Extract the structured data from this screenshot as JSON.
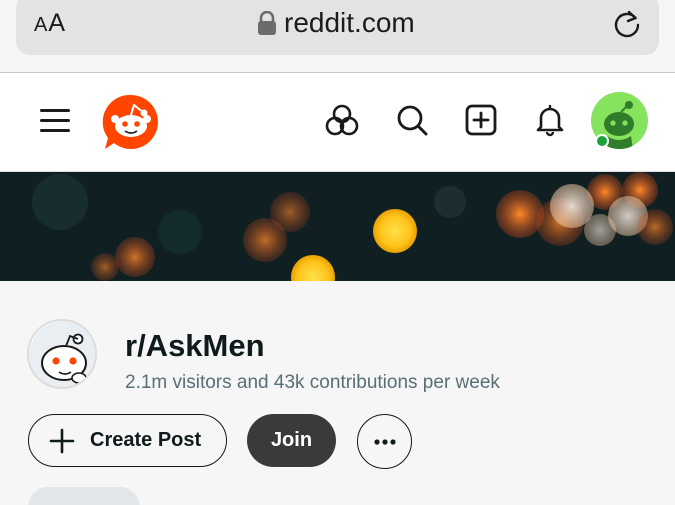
{
  "browser": {
    "text_size_label_small": "A",
    "text_size_label_large": "A",
    "url": "reddit.com"
  },
  "header": {
    "icons": [
      "menu-icon",
      "reddit-logo",
      "explore-icon",
      "search-icon",
      "create-post-icon",
      "notifications-icon",
      "user-avatar"
    ]
  },
  "community": {
    "name": "r/AskMen",
    "stats": "2.1m visitors and 43k contributions per week",
    "create_post_label": "Create Post",
    "join_label": "Join"
  },
  "colors": {
    "reddit_orange": "#ff4500",
    "join_button": "#3a3a3a",
    "avatar_bg": "#86e35d",
    "online": "#1aa33a"
  }
}
